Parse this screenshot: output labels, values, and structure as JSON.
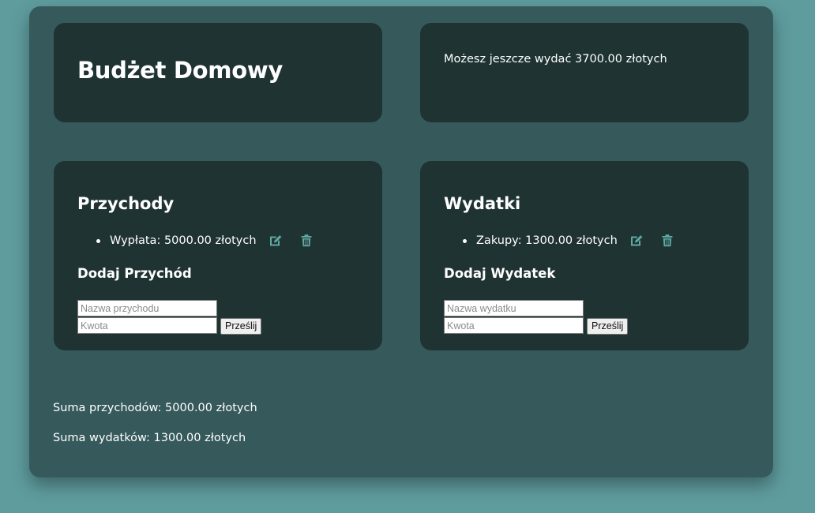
{
  "header": {
    "title": "Budżet Domowy",
    "remaining_text": "Możesz jeszcze wydać 3700.00 złotych"
  },
  "income": {
    "title": "Przychody",
    "items": [
      {
        "label": "Wypłata: 5000.00 złotych",
        "edit_icon": "edit-icon",
        "delete_icon": "trash-icon"
      }
    ],
    "form_title": "Dodaj Przychód",
    "name_placeholder": "Nazwa przychodu",
    "amount_placeholder": "Kwota",
    "submit_label": "Prześlij"
  },
  "expense": {
    "title": "Wydatki",
    "items": [
      {
        "label": "Zakupy: 1300.00 złotych",
        "edit_icon": "edit-icon",
        "delete_icon": "trash-icon"
      }
    ],
    "form_title": "Dodaj Wydatek",
    "name_placeholder": "Nazwa wydatku",
    "amount_placeholder": "Kwota",
    "submit_label": "Prześlij"
  },
  "summary": {
    "income_total": "Suma przychodów: 5000.00 złotych",
    "expense_total": "Suma wydatków: 1300.00 złotych"
  },
  "colors": {
    "page_bg": "#5f9c9e",
    "panel_bg": "#36595c",
    "card_bg": "#1f3333",
    "icon": "#5fa9a3",
    "text": "#ffffff"
  }
}
